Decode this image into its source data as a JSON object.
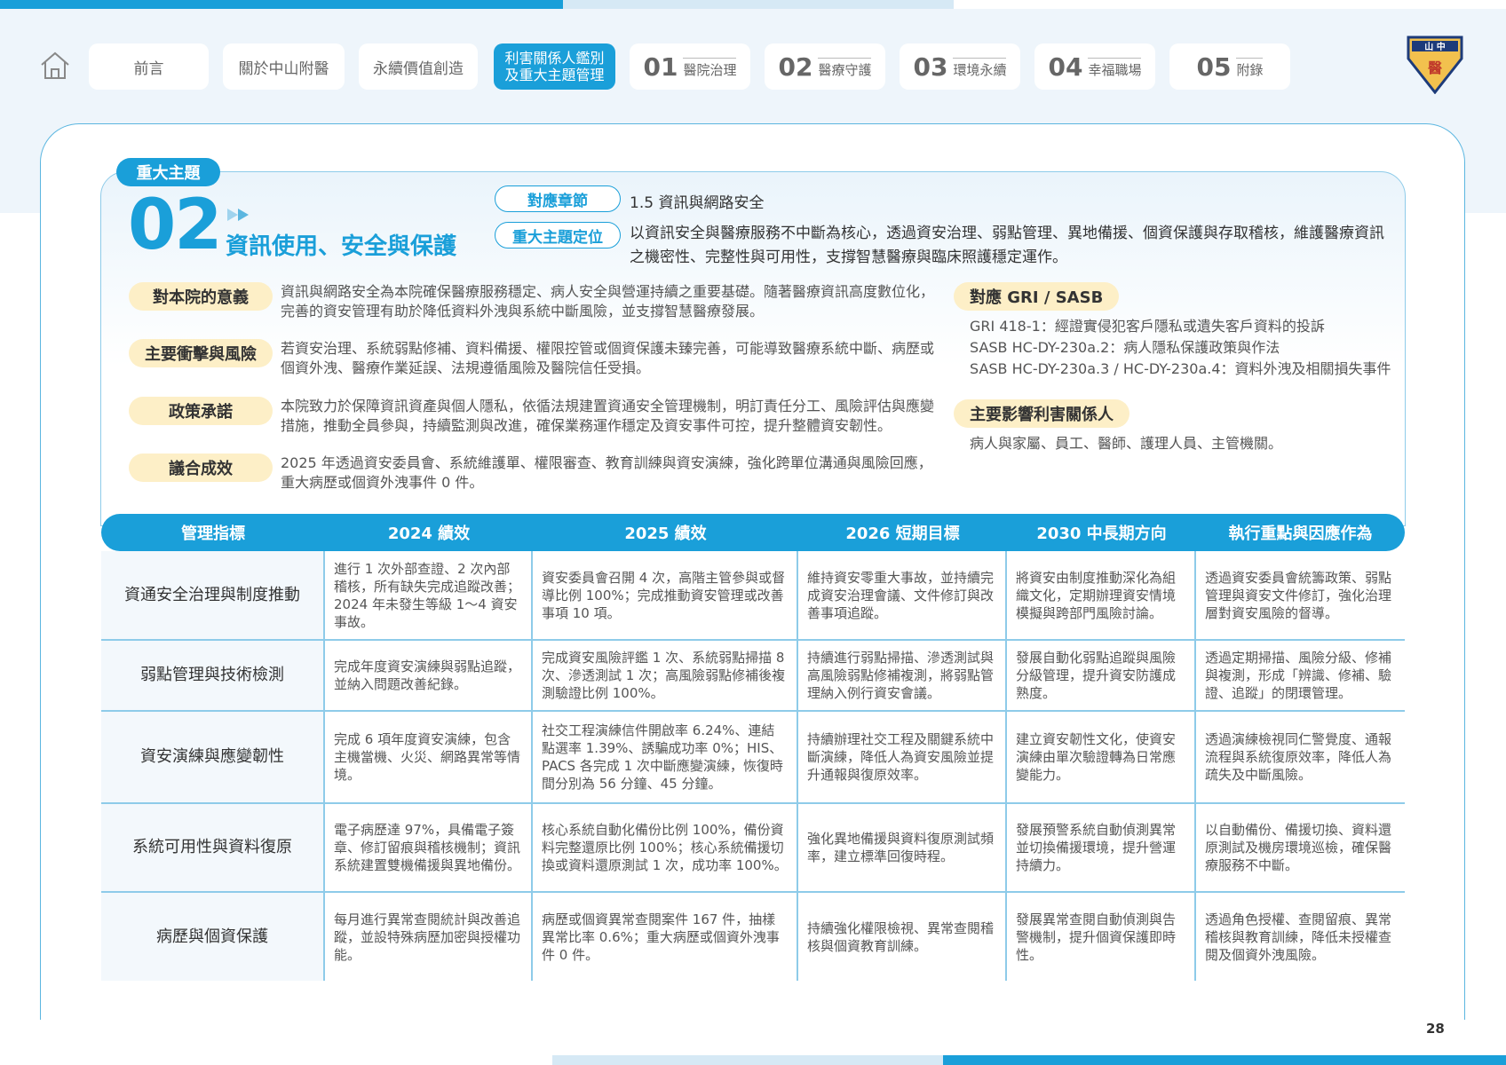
{
  "nav": {
    "items": [
      {
        "label": "前言"
      },
      {
        "label": "關於中山附醫"
      },
      {
        "label": "永續價值創造"
      },
      {
        "label": "利害關係人鑑別及重大主題管理",
        "line1": "利害關係人鑑別",
        "line2": "及重大主題管理"
      },
      {
        "num": "01",
        "label": "醫院治理"
      },
      {
        "num": "02",
        "label": "醫療守護"
      },
      {
        "num": "03",
        "label": "環境永續"
      },
      {
        "num": "04",
        "label": "幸福職場"
      },
      {
        "num": "05",
        "label": "附錄"
      }
    ]
  },
  "logo_text": "中山醫",
  "topic": {
    "tag": "重大主題",
    "number": "02",
    "title": "資訊使用、安全與保護",
    "chapter_label": "對應章節",
    "chapter_value": "1.5 資訊與網路安全",
    "position_label": "重大主題定位",
    "position_value": "以資訊安全與醫療服務不中斷為核心，透過資安治理、弱點管理、異地備援、個資保護與存取稽核，維護醫療資訊之機密性、完整性與可用性，支撐智慧醫療與臨床照護穩定運作。"
  },
  "sections": [
    {
      "label": "對本院的意義",
      "text": "資訊與網路安全為本院確保醫療服務穩定、病人安全與營運持續之重要基礎。隨著醫療資訊高度數位化，完善的資安管理有助於降低資料外洩與系統中斷風險，並支撐智慧醫療發展。"
    },
    {
      "label": "主要衝擊與風險",
      "text": "若資安治理、系統弱點修補、資料備援、權限控管或個資保護未臻完善，可能導致醫療系統中斷、病歷或個資外洩、醫療作業延誤、法規遵循風險及醫院信任受損。"
    },
    {
      "label": "政策承諾",
      "text": "本院致力於保障資訊資產與個人隱私，依循法規建置資通安全管理機制，明訂責任分工、風險評估與應變措施，推動全員參與，持續監測與改進，確保業務運作穩定及資安事件可控，提升整體資安韌性。"
    },
    {
      "label": "議合成效",
      "text": "2025 年透過資安委員會、系統維護單、權限審查、教育訓練與資安演練，強化跨單位溝通與風險回應，重大病歷或個資外洩事件 0 件。"
    }
  ],
  "gri": {
    "label": "對應 GRI / SASB",
    "lines": [
      "GRI 418-1：經證實侵犯客戶隱私或遺失客戶資料的投訴",
      "SASB HC-DY-230a.2：病人隱私保護政策與作法",
      "SASB HC-DY-230a.3 / HC-DY-230a.4：資料外洩及相關損失事件"
    ]
  },
  "stakeholders": {
    "label": "主要影響利害關係人",
    "text": "病人與家屬、員工、醫師、護理人員、主管機關。"
  },
  "table": {
    "headers": [
      "管理指標",
      "2024 績效",
      "2025 績效",
      "2026 短期目標",
      "2030 中長期方向",
      "執行重點與因應作為"
    ],
    "rows": [
      [
        "資通安全治理與制度推動",
        "進行 1 次外部查證、2 次內部稽核，所有缺失完成追蹤改善；2024 年未發生等級 1～4 資安事故。",
        "資安委員會召開 4 次，高階主管參與或督導比例 100%；完成推動資安管理或改善事項 10 項。",
        "維持資安零重大事故，並持續完成資安治理會議、文件修訂與改善事項追蹤。",
        "將資安由制度推動深化為組織文化，定期辦理資安情境模擬與跨部門風險討論。",
        "透過資安委員會統籌政策、弱點管理與資安文件修訂，強化治理層對資安風險的督導。"
      ],
      [
        "弱點管理與技術檢測",
        "完成年度資安演練與弱點追蹤，並納入問題改善紀錄。",
        "完成資安風險評鑑 1 次、系統弱點掃描 8 次、滲透測試 1 次；高風險弱點修補後複測驗證比例 100%。",
        "持續進行弱點掃描、滲透測試與高風險弱點修補複測，將弱點管理納入例行資安會議。",
        "發展自動化弱點追蹤與風險分級管理，提升資安防護成熟度。",
        "透過定期掃描、風險分級、修補與複測，形成「辨識、修補、驗證、追蹤」的閉環管理。"
      ],
      [
        "資安演練與應變韌性",
        "完成 6 項年度資安演練，包含主機當機、火災、網路異常等情境。",
        "社交工程演練信件開啟率 6.24%、連結點選率 1.39%、誘騙成功率 0%；HIS、PACS 各完成 1 次中斷應變演練，恢復時間分別為 56 分鐘、45 分鐘。",
        "持續辦理社交工程及關鍵系統中斷演練，降低人為資安風險並提升通報與復原效率。",
        "建立資安韌性文化，使資安演練由單次驗證轉為日常應變能力。",
        "透過演練檢視同仁警覺度、通報流程與系統復原效率，降低人為疏失及中斷風險。"
      ],
      [
        "系統可用性與資料復原",
        "電子病歷達 97%，具備電子簽章、修訂留痕與稽核機制；資訊系統建置雙機備援與異地備份。",
        "核心系統自動化備份比例 100%，備份資料完整還原比例 100%；核心系統備援切換或資料還原測試 1 次，成功率 100%。",
        "強化異地備援與資料復原測試頻率，建立標準回復時程。",
        "發展預警系統自動偵測異常並切換備援環境，提升營運持續力。",
        "以自動備份、備援切換、資料還原測試及機房環境巡檢，確保醫療服務不中斷。"
      ],
      [
        "病歷與個資保護",
        "每月進行異常查閱統計與改善追蹤，並設特殊病歷加密與授權功能。",
        "病歷或個資異常查閱案件 167 件，抽樣異常比率 0.6%；重大病歷或個資外洩事件 0 件。",
        "持續強化權限檢視、異常查閱稽核與個資教育訓練。",
        "發展異常查閱自動偵測與告警機制，提升個資保護即時性。",
        "透過角色授權、查閱留痕、異常稽核與教育訓練，降低未授權查閱及個資外洩風險。"
      ]
    ]
  },
  "page_number": "28"
}
